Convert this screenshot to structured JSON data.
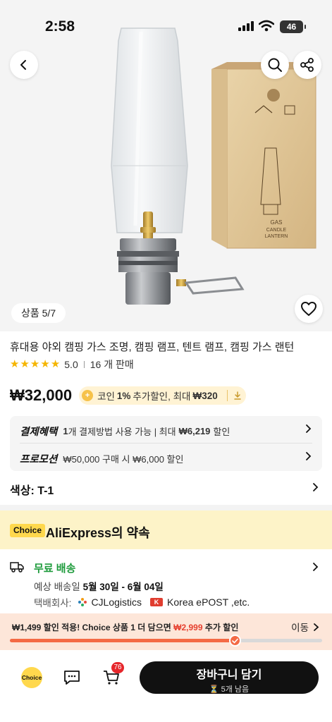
{
  "status_bar": {
    "time": "2:58",
    "battery": "46"
  },
  "gallery": {
    "counter": "상품 5/7"
  },
  "product": {
    "title": "휴대용 야외 캠핑 가스 조명, 캠핑 램프, 텐트 램프, 캠핑 가스 랜턴",
    "rating": "5.0",
    "stars": 5,
    "sold": "16 개 판매",
    "price": "₩32,000",
    "coin_prefix": "코인",
    "coin_pct": "1%",
    "coin_mid": "추가할인, 최대",
    "coin_max": "₩320"
  },
  "benefits": {
    "payment_tag": "결제혜택",
    "payment_count": "1",
    "payment_text": "개 결제방법 사용 가능 | 최대",
    "payment_max": "₩6,219",
    "payment_suffix": "할인",
    "promo_tag": "프로모션",
    "promo_text": "₩50,000 구매 시 ₩6,000 할인"
  },
  "variant": {
    "label": "색상: T-1"
  },
  "choice": {
    "badge": "Choice",
    "title": "AliExpress의 약속"
  },
  "shipping": {
    "title": "무료 배송",
    "eta_label": "예상 배송일",
    "eta_range": "5월 30일 - 6월 04일",
    "carrier_label": "택배회사:",
    "carrier_1": "CJLogistics",
    "carrier_2": "Korea ePOST ,etc."
  },
  "promo_bar": {
    "t1": "₩1,499",
    "t2": "할인 적용!",
    "t3": "Choice 상품 1 더 담으면",
    "t4": "₩2,999",
    "t5": "추가 할인",
    "go": "이동",
    "progress": 0.72
  },
  "bottom": {
    "choice_label": "Choice",
    "cart_count": "76",
    "cta_label": "장바구니 담기",
    "cta_sub": "⏳ 5개 남음"
  },
  "colors": {
    "accent_red": "#e6402f",
    "green": "#1e9b3c",
    "choice_yellow": "#ffd84d"
  }
}
